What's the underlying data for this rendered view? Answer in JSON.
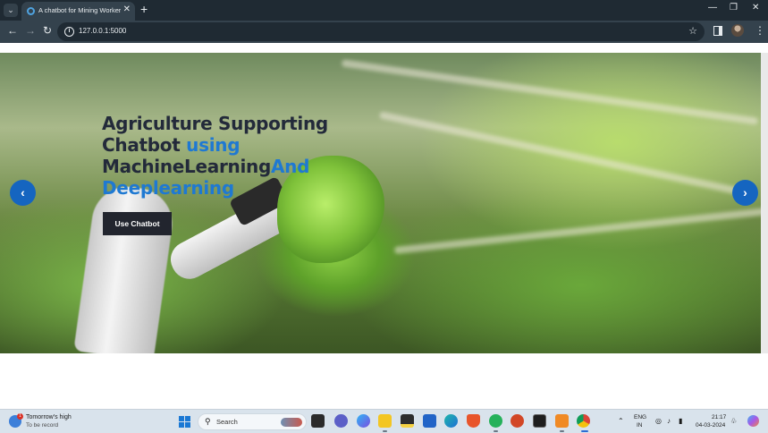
{
  "browser": {
    "tab_title": "A chatbot for Mining Worker Sa",
    "url": "127.0.0.1:5000",
    "window_controls": {
      "minimize": "—",
      "maximize": "❐",
      "close": "✕"
    }
  },
  "hero": {
    "title_segments": [
      {
        "text": "Agriculture Supporting ",
        "accent": false
      },
      {
        "text": "Chatbot ",
        "accent": false
      },
      {
        "text": "using",
        "accent": true
      },
      {
        "text": " MachineLearning",
        "accent": false
      },
      {
        "text": "And",
        "accent": true
      },
      {
        "text": " Deeplearning",
        "accent": true
      }
    ],
    "cta_label": "Use Chatbot",
    "prev_symbol": "‹",
    "next_symbol": "›"
  },
  "taskbar": {
    "weather_line1": "Tomorrow's high",
    "weather_line2": "To be record",
    "weather_badge": "1",
    "search_placeholder": "Search",
    "language_line1": "ENG",
    "language_line2": "IN",
    "time": "21:17",
    "date": "04-03-2024",
    "apps": [
      "task-view-icon",
      "teams-chat-icon",
      "copilot-icon",
      "file-explorer-icon",
      "sticky-notes-icon",
      "store-icon",
      "edge-icon",
      "brave-icon",
      "whatsapp-icon",
      "powerpoint-icon",
      "terminal-icon",
      "xampp-icon",
      "chrome-icon"
    ]
  },
  "colors": {
    "accent": "#1f79d2",
    "title_dark": "#232a3a",
    "carousel_button": "#1565c0",
    "cta_background": "#22252e"
  }
}
